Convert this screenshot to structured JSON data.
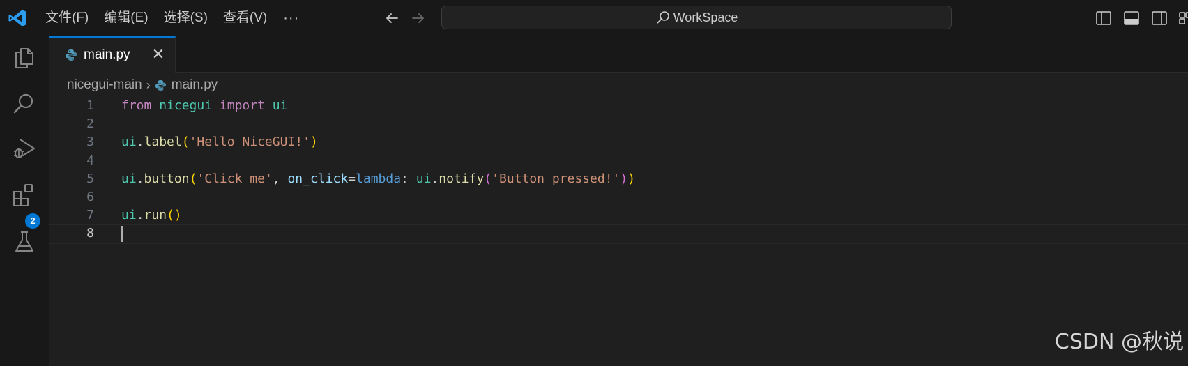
{
  "menu": {
    "items": [
      "文件(F)",
      "编辑(E)",
      "选择(S)",
      "查看(V)"
    ],
    "more": "···"
  },
  "command_center": {
    "label": "WorkSpace"
  },
  "activity_bar": {
    "extensions_badge": "2"
  },
  "tab": {
    "label": "main.py",
    "close": "✕"
  },
  "breadcrumb": {
    "folder": "nicegui-main",
    "separator": "›",
    "file": "main.py"
  },
  "editor": {
    "language": "python",
    "cursor_line": 8,
    "lines": [
      {
        "n": "1",
        "tokens": [
          [
            "kw",
            "from"
          ],
          [
            "punc",
            " "
          ],
          [
            "mod",
            "nicegui"
          ],
          [
            "punc",
            " "
          ],
          [
            "kw",
            "import"
          ],
          [
            "punc",
            " "
          ],
          [
            "mod",
            "ui"
          ]
        ]
      },
      {
        "n": "2",
        "tokens": []
      },
      {
        "n": "3",
        "tokens": [
          [
            "var",
            "ui"
          ],
          [
            "punc",
            "."
          ],
          [
            "fn",
            "label"
          ],
          [
            "b1",
            "("
          ],
          [
            "str",
            "'Hello NiceGUI!'"
          ],
          [
            "b1",
            ")"
          ]
        ]
      },
      {
        "n": "4",
        "tokens": []
      },
      {
        "n": "5",
        "tokens": [
          [
            "var",
            "ui"
          ],
          [
            "punc",
            "."
          ],
          [
            "fn",
            "button"
          ],
          [
            "b1",
            "("
          ],
          [
            "str",
            "'Click me'"
          ],
          [
            "punc",
            ", "
          ],
          [
            "param",
            "on_click"
          ],
          [
            "punc",
            "="
          ],
          [
            "lam",
            "lambda"
          ],
          [
            "punc",
            ": "
          ],
          [
            "var",
            "ui"
          ],
          [
            "punc",
            "."
          ],
          [
            "fn",
            "notify"
          ],
          [
            "b2",
            "("
          ],
          [
            "str",
            "'Button pressed!'"
          ],
          [
            "b2",
            ")"
          ],
          [
            "b1",
            ")"
          ]
        ]
      },
      {
        "n": "6",
        "tokens": []
      },
      {
        "n": "7",
        "tokens": [
          [
            "var",
            "ui"
          ],
          [
            "punc",
            "."
          ],
          [
            "fn",
            "run"
          ],
          [
            "b1",
            "()"
          ]
        ]
      },
      {
        "n": "8",
        "tokens": []
      }
    ]
  },
  "watermark": "CSDN @秋说",
  "colors": {
    "accent": "#0078d4",
    "editor_bg": "#1f1f1f",
    "chrome_bg": "#181818"
  }
}
